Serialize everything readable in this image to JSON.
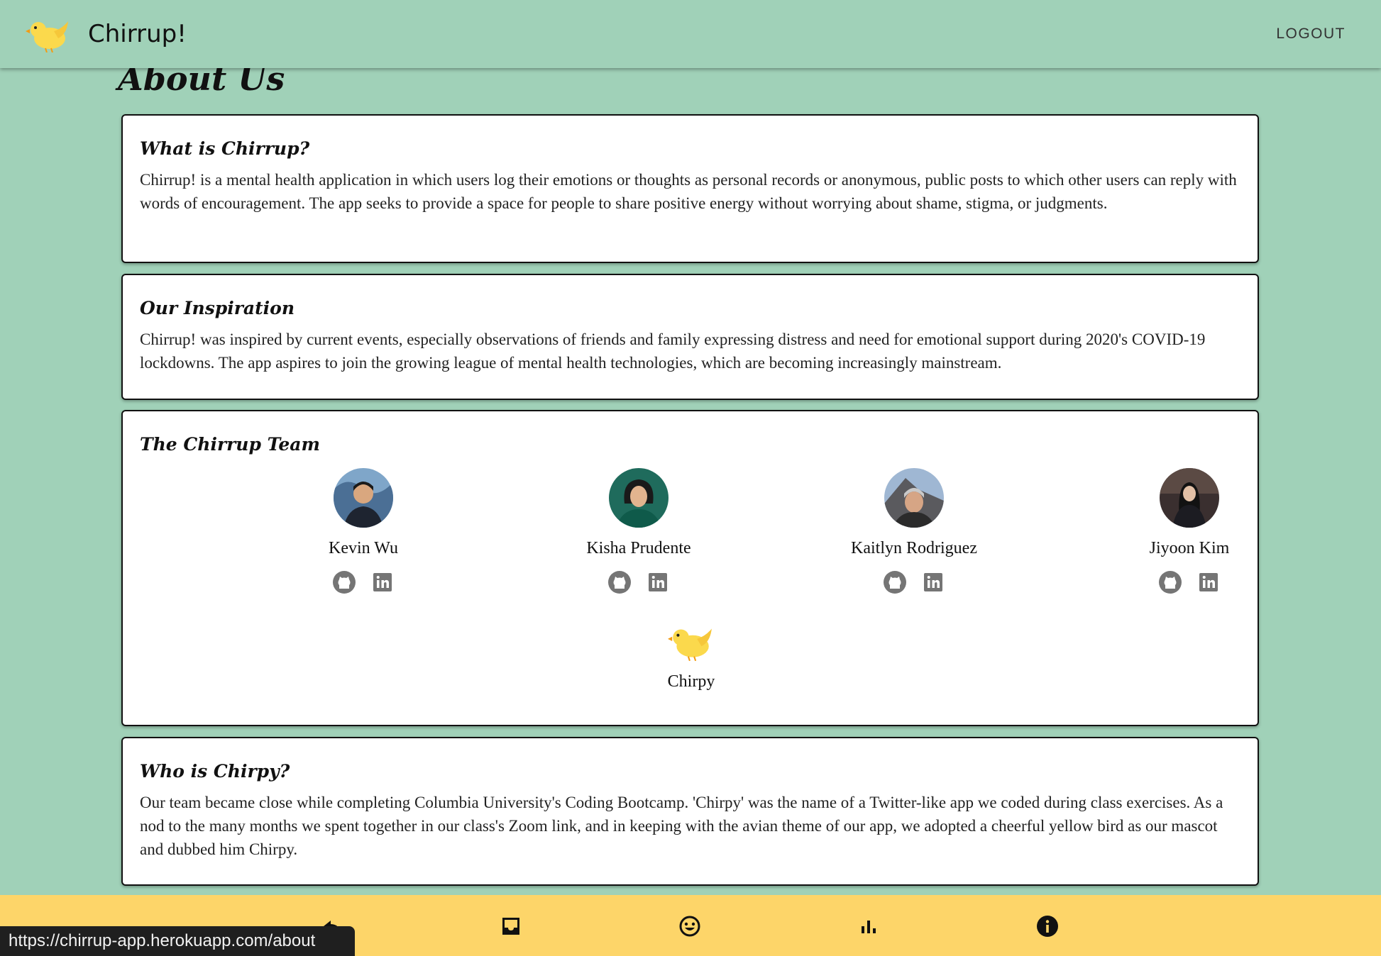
{
  "app": {
    "name": "Chirrup!",
    "logout_label": "LOGOUT"
  },
  "page": {
    "title": "About Us"
  },
  "sections": {
    "what": {
      "title": "What is Chirrup?",
      "text": "Chirrup! is a mental health application in which users log their emotions or thoughts as personal records or anonymous, public posts to which other users can reply with words of encouragement. The app seeks to provide a space for people to share positive energy without worrying about shame, stigma, or judgments."
    },
    "inspiration": {
      "title": "Our Inspiration",
      "text": "Chirrup! was inspired by current events, especially observations of friends and family expressing distress and need for emotional support during 2020's COVID-19 lockdowns. The app aspires to join the growing league of mental health technologies, which are becoming increasingly mainstream."
    },
    "team": {
      "title": "The Chirrup Team",
      "members": [
        {
          "name": "Kevin Wu"
        },
        {
          "name": "Kisha Prudente"
        },
        {
          "name": "Kaitlyn Rodriguez"
        },
        {
          "name": "Jiyoon Kim"
        }
      ],
      "mascot": {
        "name": "Chirpy"
      }
    },
    "chirpy": {
      "title": "Who is Chirpy?",
      "text": "Our team became close while completing Columbia University's Coding Bootcamp. 'Chirpy' was the name of a Twitter-like app we coded during class exercises. As a nod to the many months we spent together in our class's Zoom link, and in keeping with the avian theme of our app, we adopted a cheerful yellow bird as our mascot and dubbed him Chirpy."
    }
  },
  "status_url": "https://chirrup-app.herokuapp.com/about",
  "colors": {
    "background": "#a0d1b8",
    "bottom_bar": "#fdd569",
    "card": "#ffffff",
    "icon_gray": "#757575"
  },
  "bottom_nav": [
    {
      "icon": "back-arrow-icon"
    },
    {
      "icon": "inbox-icon"
    },
    {
      "icon": "smiley-icon"
    },
    {
      "icon": "bar-chart-icon"
    },
    {
      "icon": "info-icon"
    }
  ]
}
